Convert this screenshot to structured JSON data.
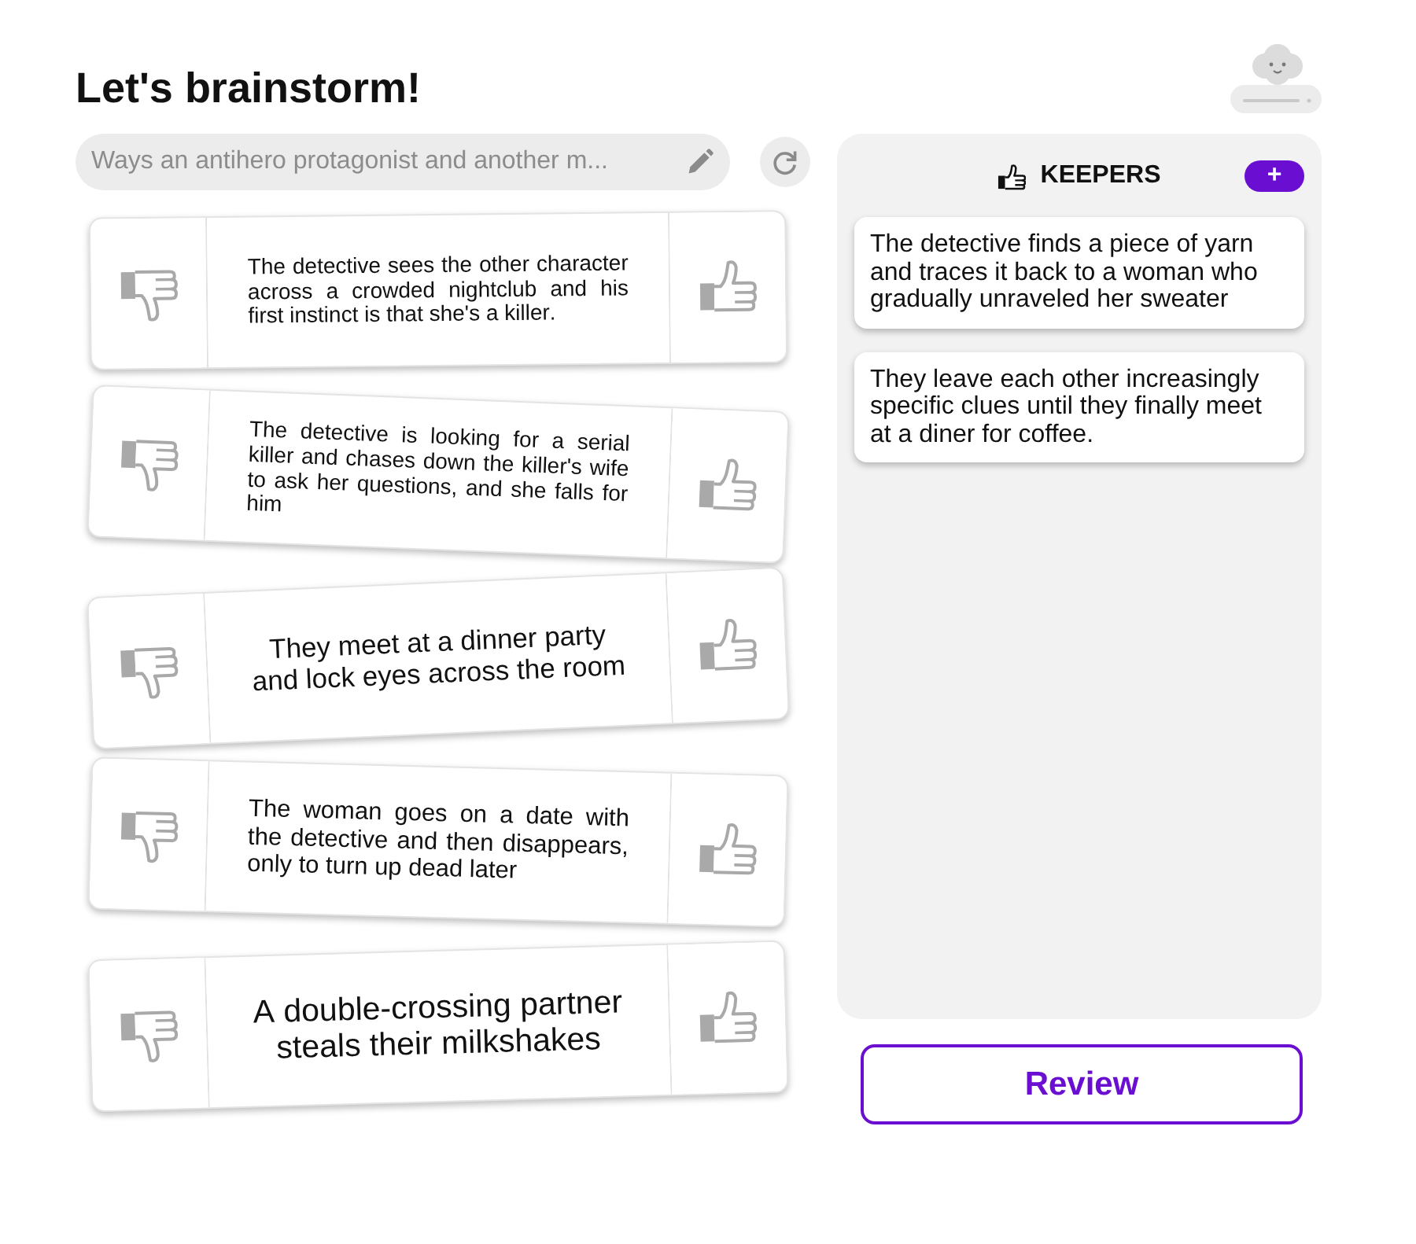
{
  "title": "Let's brainstorm!",
  "prompt_field": {
    "value": "Ways an antihero protagonist and another m..."
  },
  "ideas": [
    {
      "text": "The detective sees the other character across a crowded nightclub and his first instinct is that she's a killer."
    },
    {
      "text": "The detective is looking for a serial killer and chases down the killer's wife to ask her questions, and she falls for him"
    },
    {
      "text": "They meet at a dinner party and lock eyes across the room"
    },
    {
      "text": "The woman goes on a date with the detective and then disappears, only to turn up dead later"
    },
    {
      "text": "A double-crossing partner steals their milkshakes"
    }
  ],
  "keepers": {
    "title": "KEEPERS",
    "add_button": "+",
    "items": [
      {
        "text": "The detective finds a piece of yarn and traces it back to a woman who gradually unraveled her sweater"
      },
      {
        "text": "They leave each other increasingly specific clues until they finally meet at a diner for coffee."
      }
    ]
  },
  "review_button": "Review"
}
